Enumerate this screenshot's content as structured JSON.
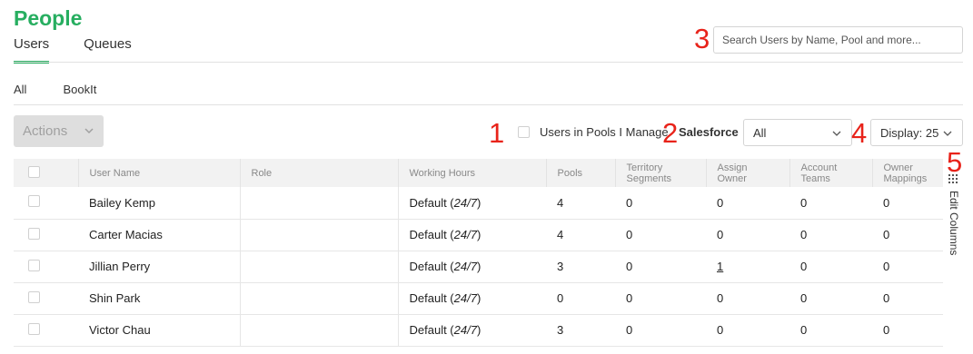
{
  "page": {
    "title": "People"
  },
  "main_tabs": [
    {
      "label": "Users",
      "active": true
    },
    {
      "label": "Queues",
      "active": false
    }
  ],
  "search": {
    "placeholder": "Search Users by Name, Pool and more..."
  },
  "sub_tabs": [
    {
      "label": "All"
    },
    {
      "label": "BookIt"
    }
  ],
  "toolbar": {
    "actions_label": "Actions",
    "pools_filter_label": "Users in Pools I Manage",
    "salesforce_label": "Salesforce",
    "salesforce_value": "All",
    "display_label": "Display: 25"
  },
  "annotations": [
    "1",
    "2",
    "3",
    "4",
    "5"
  ],
  "table": {
    "columns": [
      "User Name",
      "Role",
      "Working Hours",
      "Pools",
      "Territory Segments",
      "Assign Owner",
      "Account Teams",
      "Owner Mappings"
    ],
    "rows": [
      {
        "name": "Bailey Kemp",
        "role": "",
        "hours_prefix": "Default (",
        "hours_em": "24/7",
        "hours_suffix": ")",
        "pools": "4",
        "territory": "0",
        "assign": "0",
        "account": "0",
        "owner": "0"
      },
      {
        "name": "Carter Macias",
        "role": "",
        "hours_prefix": "Default (",
        "hours_em": "24/7",
        "hours_suffix": ")",
        "pools": "4",
        "territory": "0",
        "assign": "0",
        "account": "0",
        "owner": "0"
      },
      {
        "name": "Jillian Perry",
        "role": "",
        "hours_prefix": "Default (",
        "hours_em": "24/7",
        "hours_suffix": ")",
        "pools": "3",
        "territory": "0",
        "assign": "1",
        "account": "0",
        "owner": "0"
      },
      {
        "name": "Shin Park",
        "role": "",
        "hours_prefix": "Default (",
        "hours_em": "24/7",
        "hours_suffix": ")",
        "pools": "0",
        "territory": "0",
        "assign": "0",
        "account": "0",
        "owner": "0"
      },
      {
        "name": "Victor Chau",
        "role": "",
        "hours_prefix": "Default (",
        "hours_em": "24/7",
        "hours_suffix": ")",
        "pools": "3",
        "territory": "0",
        "assign": "0",
        "account": "0",
        "owner": "0"
      }
    ]
  },
  "edit_columns_label": "Edit Columns",
  "colors": {
    "brand": "#27ae60",
    "annotation": "#e8231a"
  }
}
